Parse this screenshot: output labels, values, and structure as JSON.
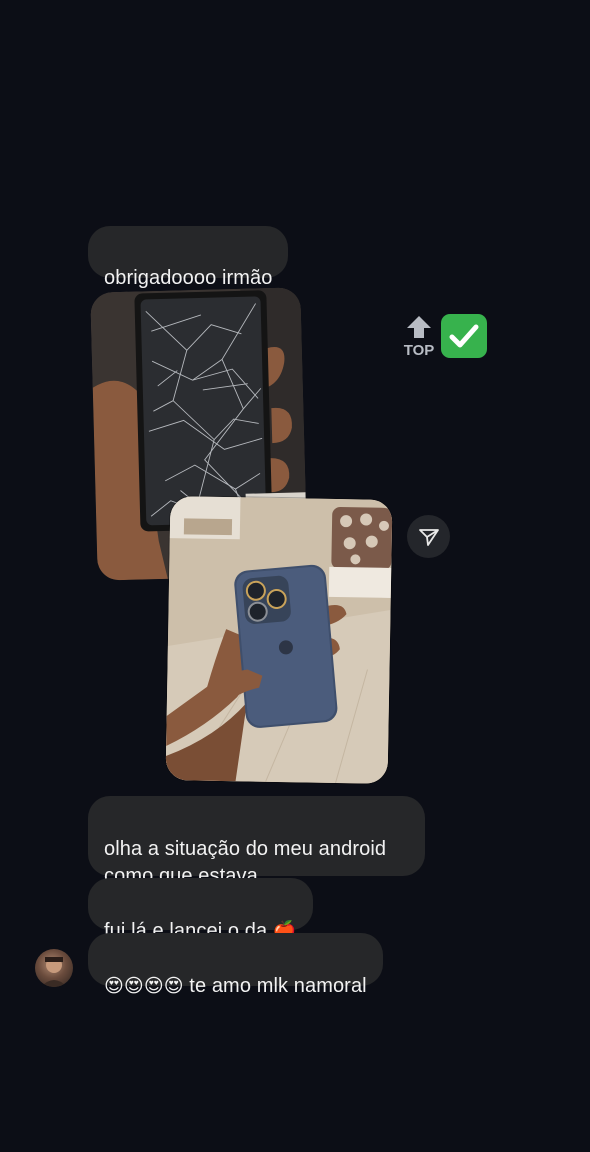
{
  "messages": [
    {
      "text": "obrigadoooo irmão"
    },
    {
      "text": "olha a situação do meu android\ncomo que estava"
    },
    {
      "text": "fui lá e lancei o da ",
      "emoji": "🍎"
    },
    {
      "emoji": "😍😍😍😍",
      "text": " te amo mlk namoral"
    }
  ],
  "reaction": {
    "top_label": "TOP",
    "check_icon": "check-mark-button-icon",
    "top_icon": "top-arrow-icon"
  },
  "icons": {
    "share": "paper-plane-icon",
    "avatar": "user-avatar"
  },
  "colors": {
    "background": "#0c0e16",
    "bubble": "#262729",
    "text": "#f2f2f2",
    "check_green": "#37b24d"
  }
}
